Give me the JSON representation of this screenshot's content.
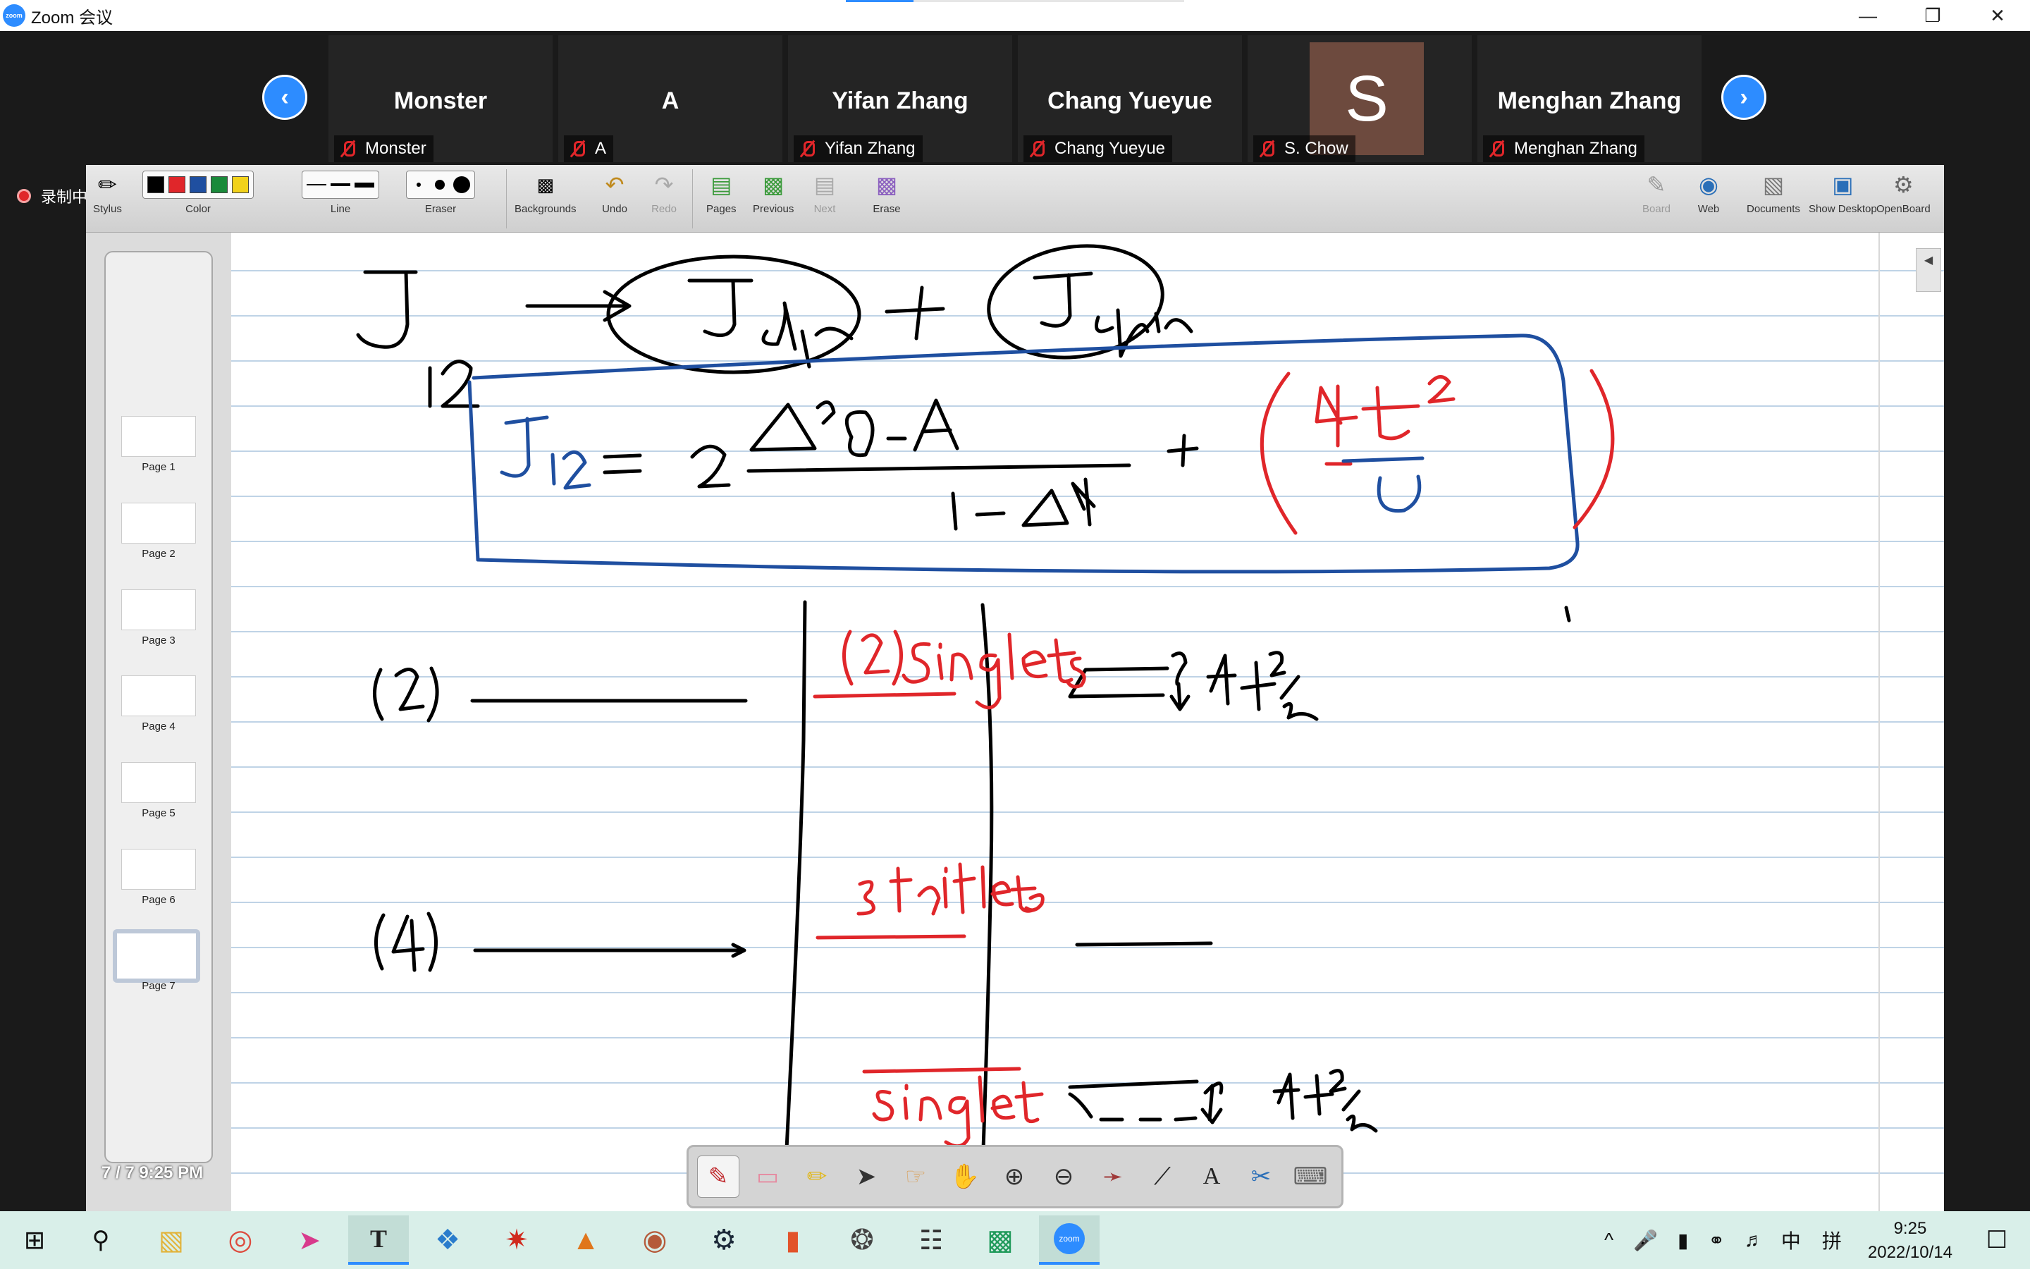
{
  "window": {
    "app_logo": "zoom",
    "title": "Zoom 会议",
    "controls": [
      "minimize-icon",
      "restore-icon",
      "close-icon"
    ]
  },
  "participants": [
    {
      "tile_name": "Monster",
      "label": "Monster",
      "muted": true
    },
    {
      "tile_name": "A",
      "label": "A",
      "muted": true
    },
    {
      "tile_name": "Yifan Zhang",
      "label": "Yifan Zhang",
      "muted": true
    },
    {
      "tile_name": "Chang Yueyue",
      "label": "Chang Yueyue",
      "muted": true
    },
    {
      "tile_name": "",
      "avatar_letter": "S",
      "label": "S. Chow",
      "muted": true
    },
    {
      "tile_name": "Menghan Zhang",
      "label": "Menghan Zhang",
      "muted": true
    }
  ],
  "recording": {
    "label": "录制中"
  },
  "openboard": {
    "toolbar": {
      "stylus": "Stylus",
      "color": "Color",
      "colors": [
        "#000000",
        "#e0262a",
        "#1f4fa0",
        "#1a8a3a",
        "#f2d21b"
      ],
      "line": "Line",
      "eraser": "Eraser",
      "backgrounds": "Backgrounds",
      "undo": "Undo",
      "redo": "Redo",
      "pages": "Pages",
      "previous": "Previous",
      "next": "Next",
      "erase": "Erase",
      "board": "Board",
      "web": "Web",
      "documents": "Documents",
      "show_desktop": "Show Desktop",
      "openboard": "OpenBoard"
    },
    "pages": [
      "Page 1",
      "Page 2",
      "Page 3",
      "Page 4",
      "Page 5",
      "Page 6",
      "Page 7"
    ],
    "current_page": 7,
    "page_counter_overlay": "7 / 7 9:25 PM"
  },
  "taskbar": {
    "time": "9:25",
    "date": "2022/10/14",
    "ime": "中",
    "ime2": "拼",
    "tray_up": "^"
  }
}
